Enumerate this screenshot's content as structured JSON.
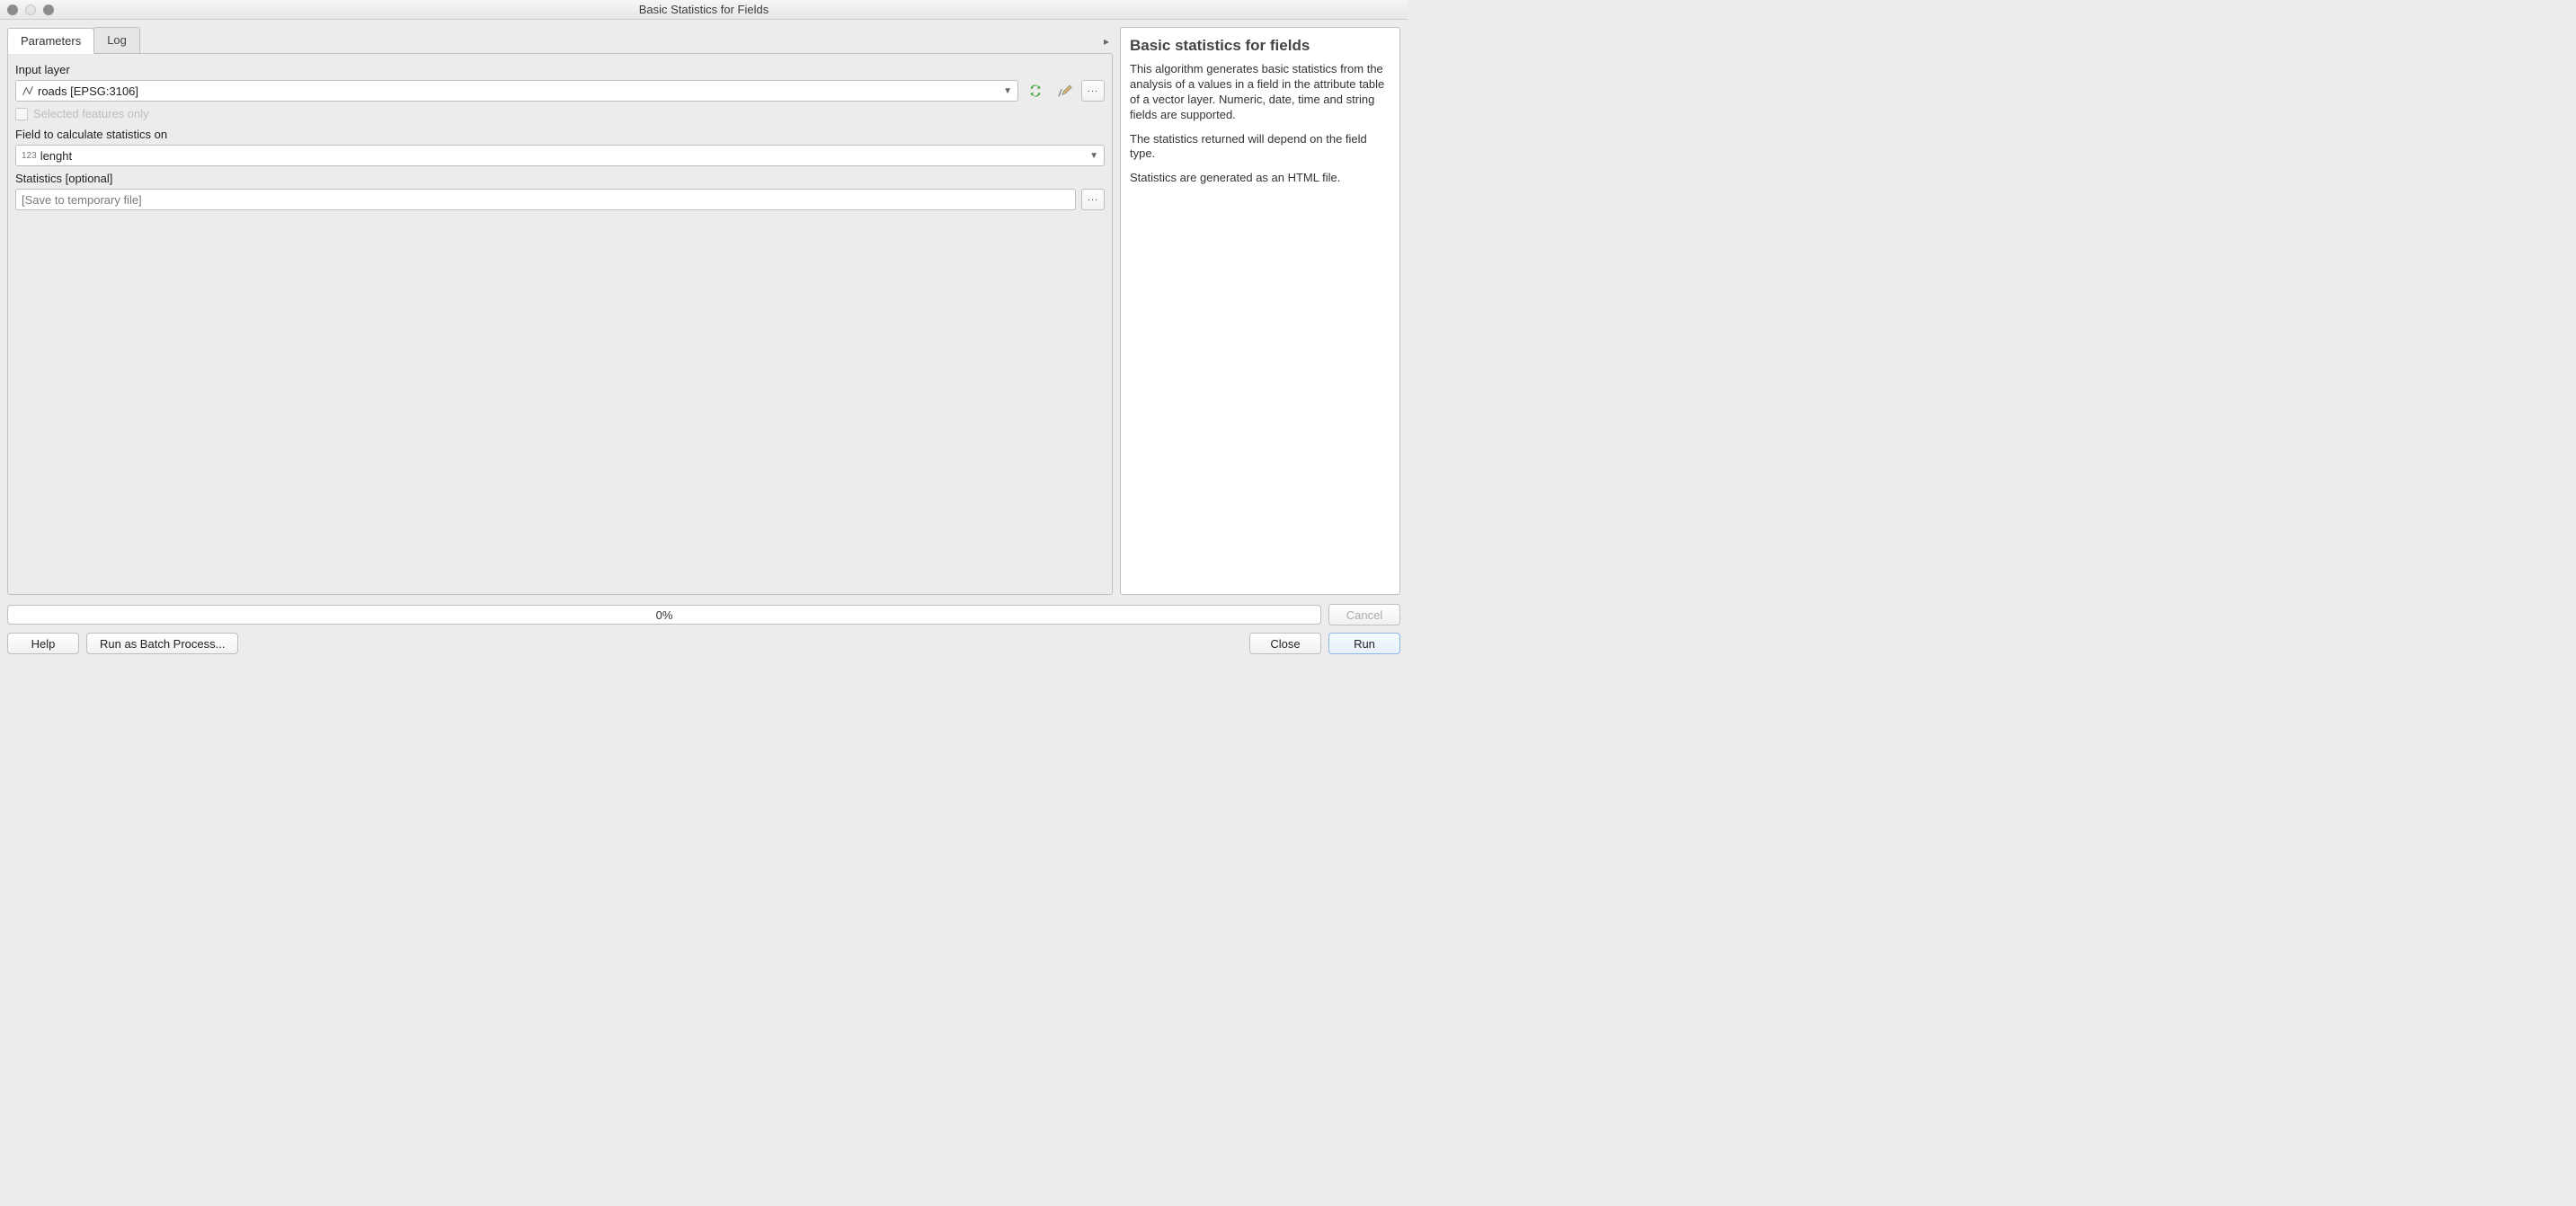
{
  "window": {
    "title": "Basic Statistics for Fields"
  },
  "tabs": {
    "parameters": "Parameters",
    "log": "Log"
  },
  "params": {
    "input_layer_label": "Input layer",
    "input_layer_value": "roads [EPSG:3106]",
    "selected_features_label": "Selected features only",
    "selected_features_enabled": false,
    "field_label": "Field to calculate statistics on",
    "field_type_badge": "123",
    "field_value": "lenght",
    "statistics_label": "Statistics [optional]",
    "statistics_placeholder": "[Save to temporary file]",
    "statistics_value": ""
  },
  "help": {
    "title": "Basic statistics for fields",
    "p1": "This algorithm generates basic statistics from the analysis of a values in a field in the attribute table of a vector layer. Numeric, date, time and string fields are supported.",
    "p2": "The statistics returned will depend on the field type.",
    "p3": "Statistics are generated as an HTML file."
  },
  "progress": {
    "text": "0%"
  },
  "buttons": {
    "cancel": "Cancel",
    "help": "Help",
    "batch": "Run as Batch Process...",
    "close": "Close",
    "run": "Run"
  }
}
